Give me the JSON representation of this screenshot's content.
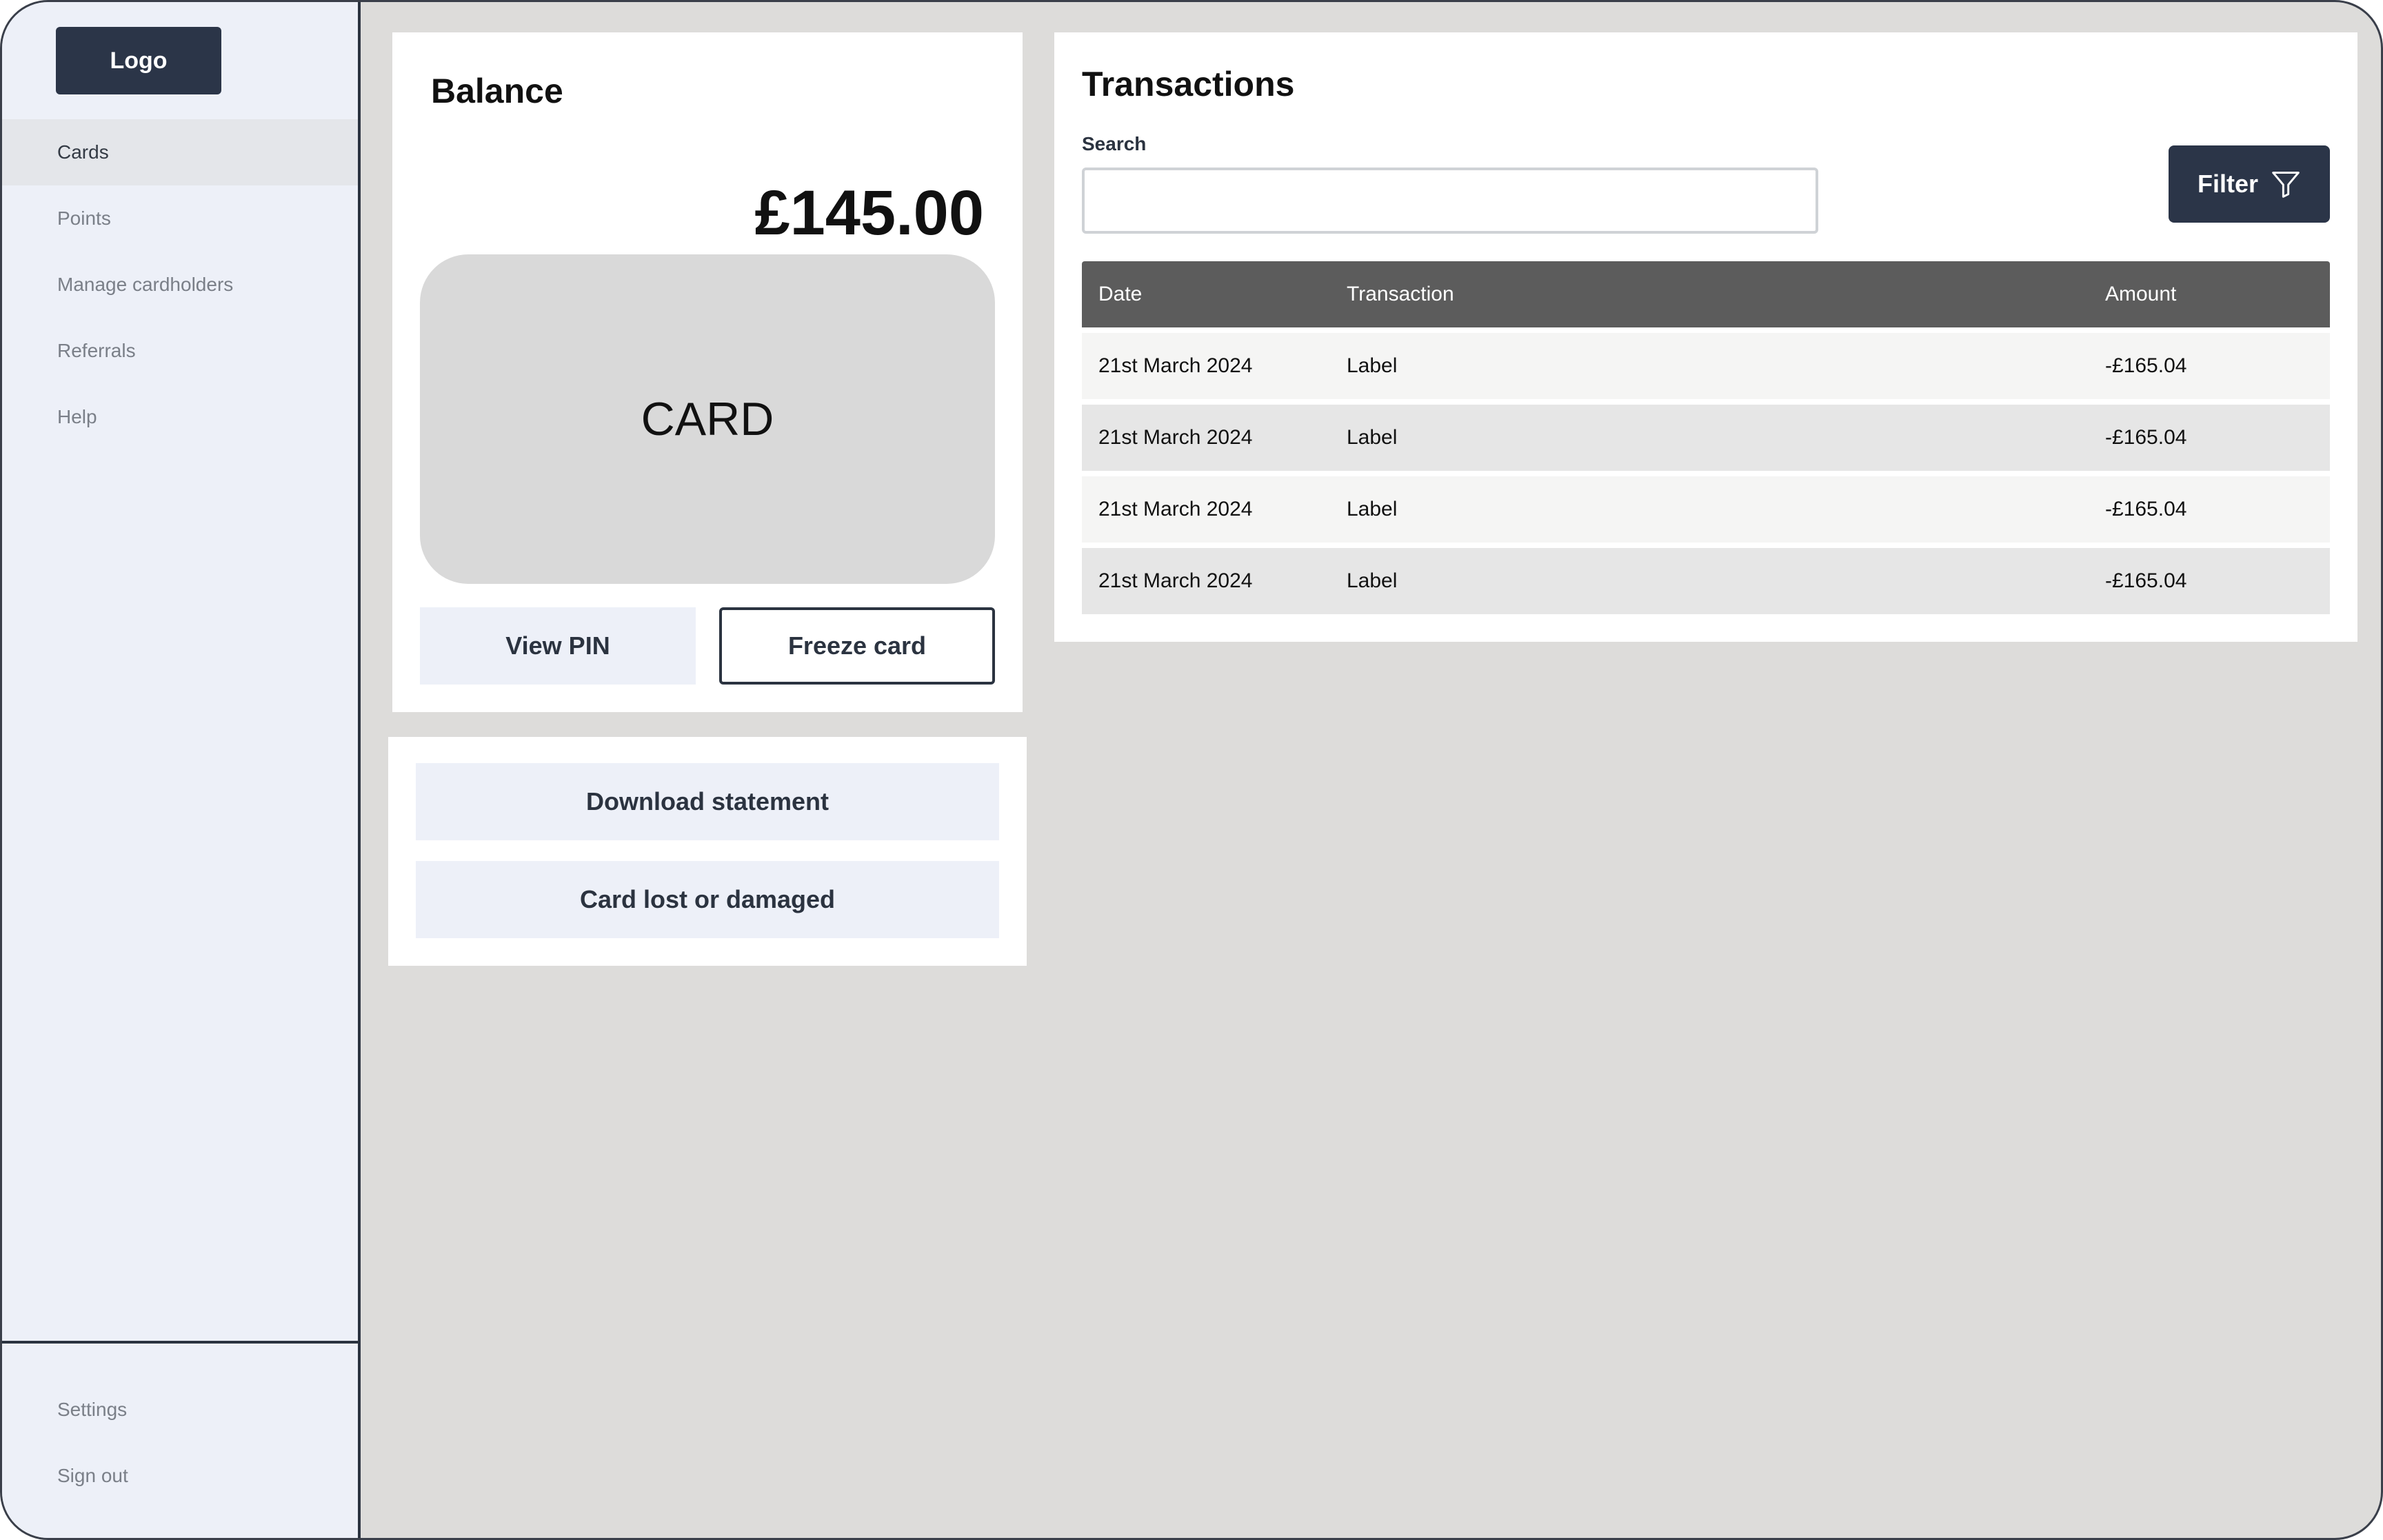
{
  "sidebar": {
    "logo": "Logo",
    "items": [
      {
        "label": "Cards"
      },
      {
        "label": "Points"
      },
      {
        "label": "Manage cardholders"
      },
      {
        "label": "Referrals"
      },
      {
        "label": "Help"
      }
    ],
    "bottom_items": [
      {
        "label": "Settings"
      },
      {
        "label": "Sign out"
      }
    ]
  },
  "balance": {
    "title": "Balance",
    "amount": "£145.00",
    "card_label": "CARD",
    "view_pin_label": "View PIN",
    "freeze_label": "Freeze card"
  },
  "actions": {
    "download_label": "Download statement",
    "lost_label": "Card lost or damaged"
  },
  "transactions": {
    "title": "Transactions",
    "search_label": "Search",
    "search_value": "",
    "filter_label": "Filter",
    "columns": {
      "date": "Date",
      "transaction": "Transaction",
      "amount": "Amount"
    },
    "rows": [
      {
        "date": "21st March 2024",
        "label": "Label",
        "amount": "-£165.04"
      },
      {
        "date": "21st March 2024",
        "label": "Label",
        "amount": "-£165.04"
      },
      {
        "date": "21st March 2024",
        "label": "Label",
        "amount": "-£165.04"
      },
      {
        "date": "21st March 2024",
        "label": "Label",
        "amount": "-£165.04"
      }
    ]
  },
  "colors": {
    "sidebar_bg": "#edf0f8",
    "primary_dark": "#2b3548",
    "page_bg": "#dddcda",
    "table_header": "#5c5c5c"
  }
}
